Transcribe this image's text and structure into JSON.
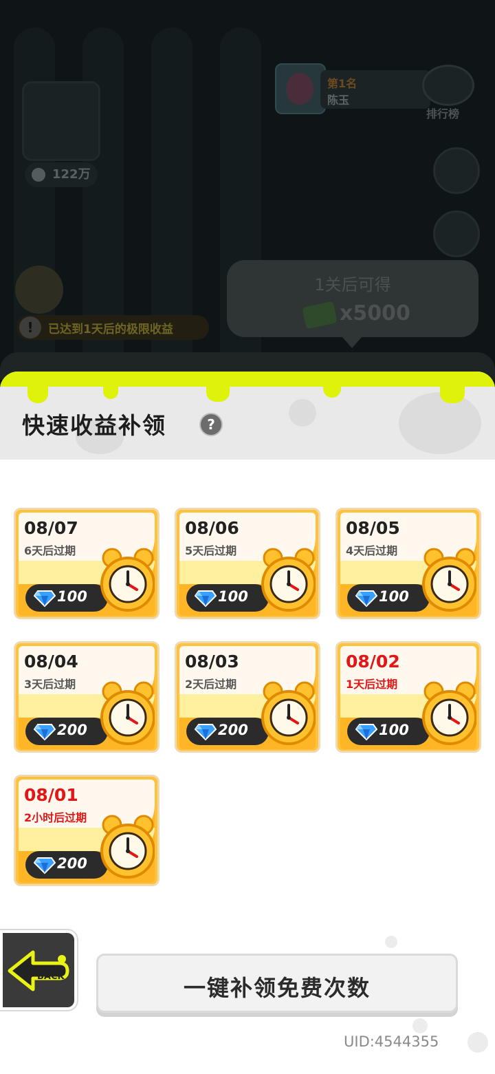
{
  "background": {
    "power": "122万",
    "rank": {
      "position": "第1名",
      "name": "陈玉",
      "button": "排行榜"
    },
    "warning": "已达到1天后的极限收益",
    "tip": {
      "title": "1关后可得",
      "amount": "x5000"
    }
  },
  "panel": {
    "title": "快速收益补领",
    "help": "?",
    "cards": [
      {
        "date": "08/07",
        "expire": "6天后过期",
        "gems": "100",
        "urgent": false
      },
      {
        "date": "08/06",
        "expire": "5天后过期",
        "gems": "100",
        "urgent": false
      },
      {
        "date": "08/05",
        "expire": "4天后过期",
        "gems": "100",
        "urgent": false
      },
      {
        "date": "08/04",
        "expire": "3天后过期",
        "gems": "200",
        "urgent": false
      },
      {
        "date": "08/03",
        "expire": "2天后过期",
        "gems": "200",
        "urgent": false
      },
      {
        "date": "08/02",
        "expire": "1天后过期",
        "gems": "100",
        "urgent": true
      },
      {
        "date": "08/01",
        "expire": "2小时后过期",
        "gems": "200",
        "urgent": true
      }
    ],
    "back_label": "BACK",
    "claim_all": "一键补领免费次数",
    "uid": "UID:4544355"
  },
  "colors": {
    "accent": "#dff30a",
    "card": "#ffb626",
    "urgent": "#e31515",
    "gem": "#3aa0ff"
  }
}
